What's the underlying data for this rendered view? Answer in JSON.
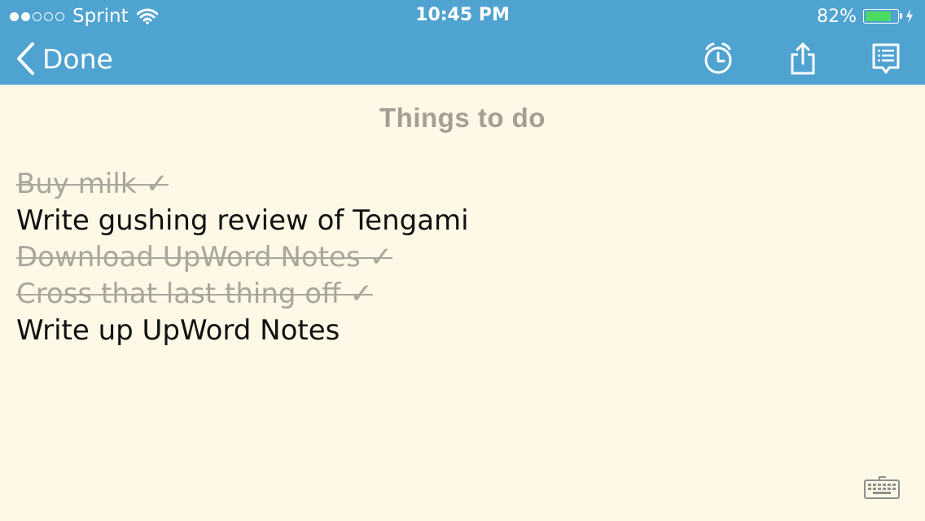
{
  "status_bar": {
    "signal_dots_filled": 2,
    "signal_dots_total": 5,
    "carrier": "Sprint",
    "time": "10:45 PM",
    "battery_percent_text": "82%",
    "battery_level": 0.82,
    "battery_color": "#4cd964",
    "icons": [
      "wifi-icon",
      "battery-icon",
      "charging-bolt-icon"
    ]
  },
  "navbar": {
    "back_label": "Done",
    "back_icon": "chevron-left-icon",
    "actions": [
      "alarm-clock-icon",
      "share-icon",
      "notes-list-icon"
    ],
    "background_color": "#4fa3d1"
  },
  "note": {
    "title": "Things to do",
    "items": [
      {
        "text": "Buy milk ✓",
        "done": true
      },
      {
        "text": "Write gushing review of Tengami",
        "done": false
      },
      {
        "text": "Download UpWord Notes ✓",
        "done": true
      },
      {
        "text": "Cross that last thing off ✓",
        "done": true
      },
      {
        "text": "Write up UpWord Notes",
        "done": false
      }
    ]
  },
  "footer": {
    "keyboard_icon": "keyboard-icon"
  }
}
